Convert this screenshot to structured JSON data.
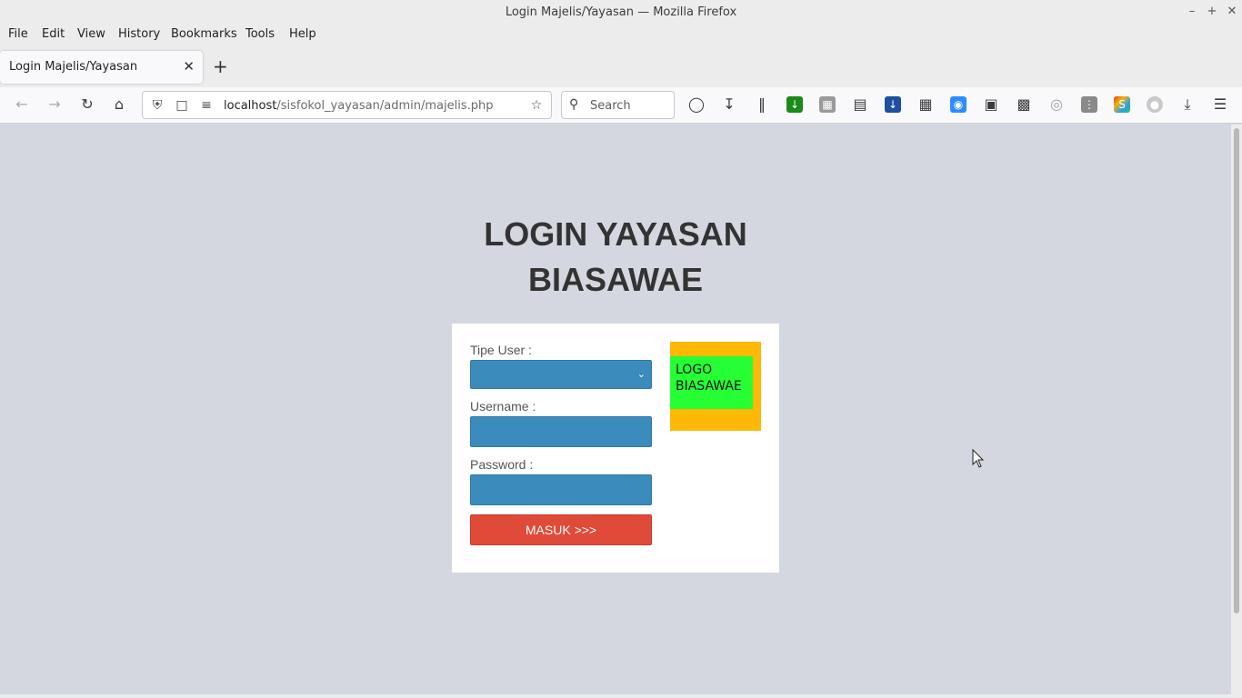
{
  "window": {
    "title": "Login Majelis/Yayasan — Mozilla Firefox"
  },
  "menu": {
    "file": "File",
    "edit": "Edit",
    "view": "View",
    "history": "History",
    "bookmarks": "Bookmarks",
    "tools": "Tools",
    "help": "Help"
  },
  "tab": {
    "label": "Login Majelis/Yayasan"
  },
  "navbar": {
    "url_host": "localhost",
    "url_path": "/sisfokol_yayasan/admin/majelis.php",
    "search_placeholder": "Search"
  },
  "page": {
    "heading_line1": "LOGIN YAYASAN",
    "heading_line2": "BIASAWAE",
    "tipe_user_label": "Tipe User :",
    "tipe_user_value": "",
    "username_label": "Username :",
    "username_value": "",
    "password_label": "Password :",
    "password_value": "",
    "submit_label": "MASUK >>>",
    "logo_line1": "LOGO",
    "logo_line2": "BIASAWAE"
  },
  "colors": {
    "field_bg": "#3b8bbd",
    "submit_bg": "#e04a38",
    "logo_outer": "#ffb806",
    "logo_inner": "#26ff33",
    "page_bg": "#d4d7df"
  }
}
